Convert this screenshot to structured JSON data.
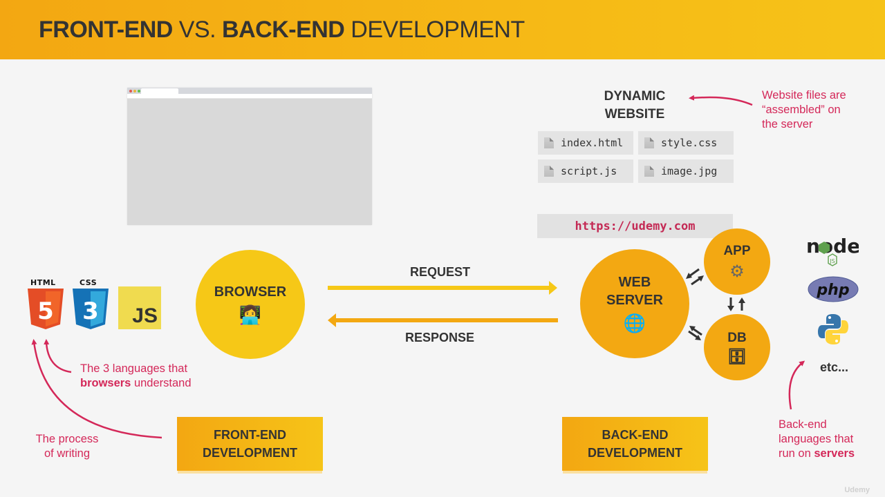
{
  "header": {
    "title_part1": "FRONT-END",
    "title_part2": " VS. ",
    "title_part3": "BACK-END",
    "title_part4": " DEVELOPMENT"
  },
  "dynamic_website": {
    "title_line1": "DYNAMIC",
    "title_line2": "WEBSITE",
    "files": [
      "index.html",
      "style.css",
      "script.js",
      "image.jpg"
    ],
    "annotation_line1": "Website files are",
    "annotation_line2": "“assembled” on",
    "annotation_line3": "the server"
  },
  "url": "https://udemy.com",
  "browser": {
    "label": "BROWSER",
    "emoji": "👩‍💻",
    "icon": "technologist-icon"
  },
  "flow": {
    "request_label": "REQUEST",
    "response_label": "RESPONSE"
  },
  "web_server": {
    "label_line1": "WEB",
    "label_line2": "SERVER",
    "emoji": "🌐",
    "icon": "globe-icon"
  },
  "app": {
    "label": "APP",
    "emoji": "⚙",
    "icon": "gear-icon"
  },
  "db": {
    "label": "DB",
    "emoji": "🗄",
    "icon": "file-cabinet-icon"
  },
  "frontend_languages": {
    "html_label": "HTML",
    "html_number": "5",
    "css_label": "CSS",
    "css_number": "3",
    "js_label": "JS"
  },
  "backend_languages": {
    "node_label": "node",
    "node_sub": "JS",
    "php_label": "php",
    "etc_label": "etc..."
  },
  "annotations": {
    "languages_line1": "The 3 languages that",
    "languages_bold": "browsers",
    "languages_line2_rest": " understand",
    "process_line1": "The process",
    "process_line2": "of writing",
    "backend_line1": "Back-end",
    "backend_line2": "languages that",
    "backend_line3_start": "run on ",
    "backend_bold": "servers"
  },
  "dev_boxes": {
    "frontend_line1": "FRONT-END",
    "frontend_line2": "DEVELOPMENT",
    "backend_line1": "BACK-END",
    "backend_line2": "DEVELOPMENT"
  },
  "colors": {
    "accent_yellow": "#f6c817",
    "accent_orange": "#f3a812",
    "annotation_red": "#d42859",
    "text_dark": "#333333"
  },
  "watermark": "Udemy"
}
